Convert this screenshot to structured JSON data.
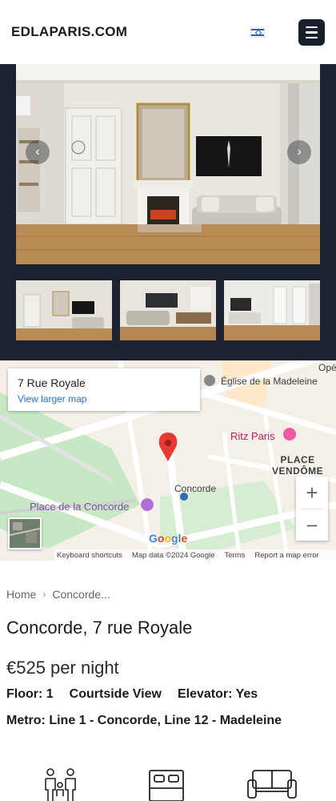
{
  "header": {
    "brand": "EDLAPARIS.COM",
    "language_flag": "israel-flag-icon",
    "menu_icon": "hamburger-menu-icon"
  },
  "gallery": {
    "prev_icon": "‹",
    "next_icon": "›",
    "thumbnail_count_visible": 3
  },
  "map": {
    "address": "7 Rue Royale",
    "view_larger": "View larger map",
    "labels": {
      "opera_partial": "Opé",
      "madeleine": "Église de la Madeleine",
      "ritz": "Ritz Paris",
      "place": "PLACE",
      "vendome": "VENDÔME",
      "concorde_station": "Concorde",
      "place_concorde": "Place de la Concorde"
    },
    "zoom_in": "+",
    "zoom_out": "−",
    "google": "Google",
    "attribution": {
      "shortcuts": "Keyboard shortcuts",
      "data": "Map data ©2024 Google",
      "terms": "Terms",
      "report": "Report a map error"
    }
  },
  "breadcrumb": {
    "home": "Home",
    "current": "Concorde..."
  },
  "listing": {
    "title": "Concorde, 7 rue Royale",
    "price": "€525 per night",
    "floor": "Floor: 1",
    "view": "Courtside View",
    "elevator": "Elevator: Yes",
    "metro": "Metro: Line 1 - Concorde, Line 12 - Madeleine"
  },
  "amenities": [
    "family-icon",
    "bed-icon",
    "sofa-icon"
  ],
  "colors": {
    "navy": "#1b2333",
    "menu_button": "#18202d",
    "map_pin": "#e53935",
    "link_blue": "#1a73e8",
    "poi_pink": "#c2185b"
  }
}
